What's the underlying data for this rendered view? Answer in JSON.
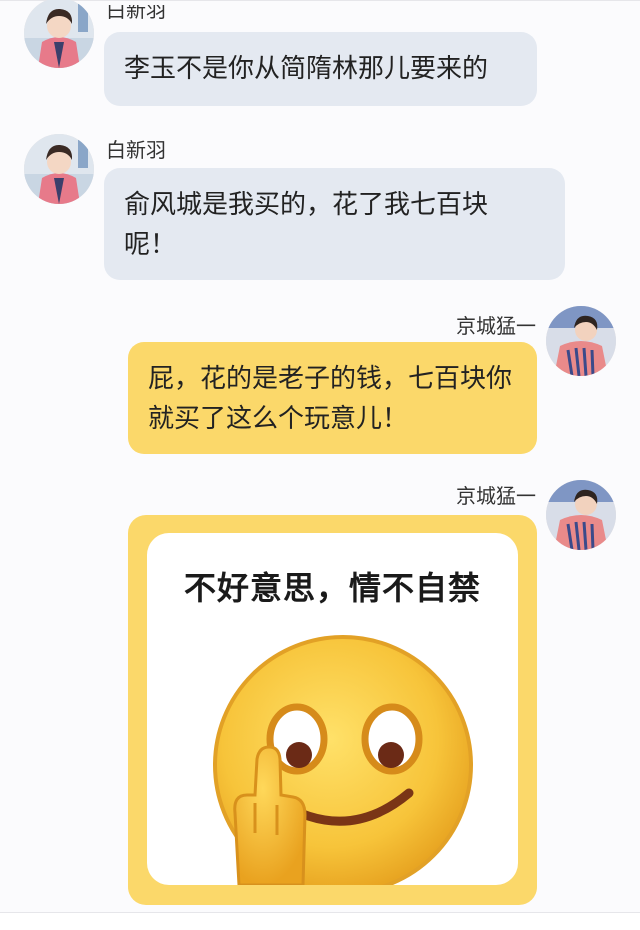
{
  "messages": [
    {
      "sender": "白新羽",
      "text": "李玉不是你从简隋林那儿要来的"
    },
    {
      "sender": "白新羽",
      "text": "俞风城是我买的，花了我七百块呢！"
    },
    {
      "sender": "京城猛一",
      "text": "屁，花的是老子的钱，七百块你就买了这么个玩意儿！"
    },
    {
      "sender": "京城猛一",
      "sticker_caption": "不好意思，情不自禁",
      "sticker_icon": "smiley-middle-finger-icon"
    }
  ],
  "colors": {
    "left_bubble": "#e4e9f1",
    "right_bubble": "#fbd86a",
    "background": "#fbfbfd"
  }
}
